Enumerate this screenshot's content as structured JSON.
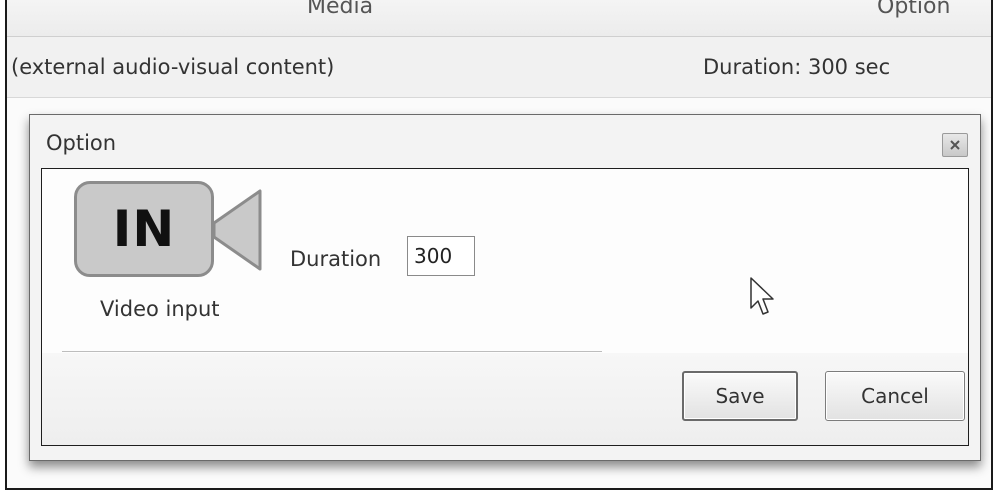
{
  "table": {
    "header": {
      "media": "Media",
      "option": "Option"
    },
    "row": {
      "media": "(external audio-visual content)",
      "option": "Duration: 300 sec"
    }
  },
  "dialog": {
    "title": "Option",
    "close_icon": "close-icon",
    "media_icon": {
      "name": "video-camera-icon",
      "text": "IN"
    },
    "media_label": "Video input",
    "duration": {
      "label": "Duration",
      "value": "300"
    },
    "buttons": {
      "save": "Save",
      "cancel": "Cancel"
    }
  },
  "colors": {
    "icon_fill": "#c9c9c9",
    "icon_border": "#8c8c8c",
    "dialog_background": "#f3f3f3"
  }
}
